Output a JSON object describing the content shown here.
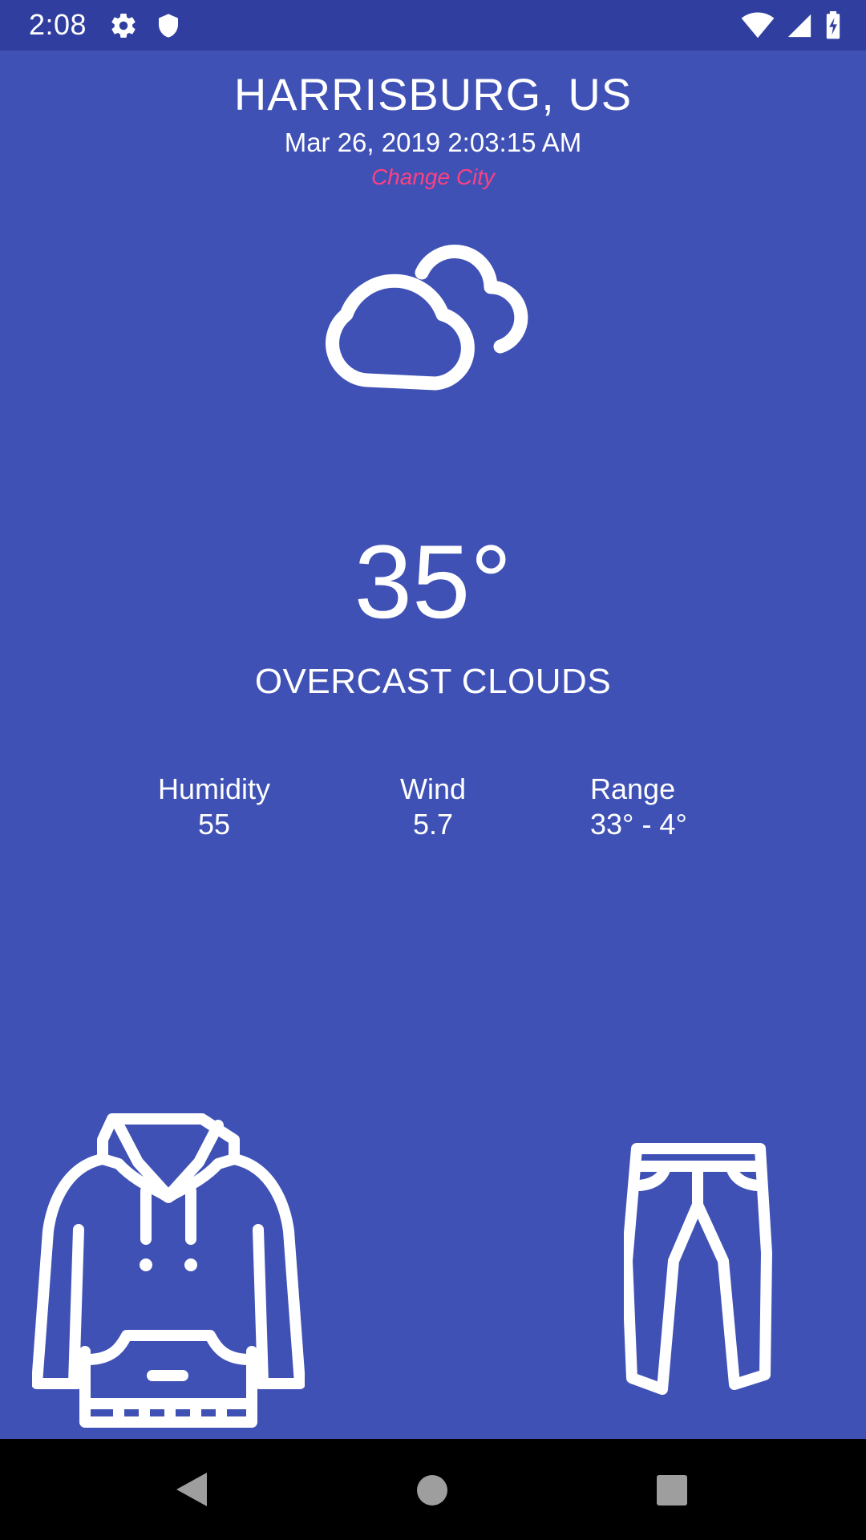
{
  "status_bar": {
    "time": "2:08",
    "icons_left": [
      "gear-icon",
      "shield-icon"
    ],
    "icons_right": [
      "wifi-icon",
      "cell-signal-icon",
      "battery-charging-icon"
    ]
  },
  "location": {
    "city": "HARRISBURG, US",
    "datetime": "Mar 26, 2019 2:03:15 AM",
    "change_city_label": "Change City"
  },
  "weather": {
    "icon": "cloudy-icon",
    "temperature": "35°",
    "condition": "OVERCAST CLOUDS"
  },
  "stats": {
    "humidity": {
      "label": "Humidity",
      "value": "55"
    },
    "wind": {
      "label": "Wind",
      "value": "5.7"
    },
    "range": {
      "label": "Range",
      "value": "33° - 4°"
    }
  },
  "clothing": {
    "top": "hoodie-icon",
    "bottom": "pants-icon"
  },
  "colors": {
    "background": "#3f51b5",
    "status_bar": "#303f9f",
    "accent": "#ff4081",
    "nav_bar": "#000000"
  },
  "nav_bar": {
    "buttons": [
      "back-icon",
      "home-icon",
      "recents-icon"
    ]
  }
}
